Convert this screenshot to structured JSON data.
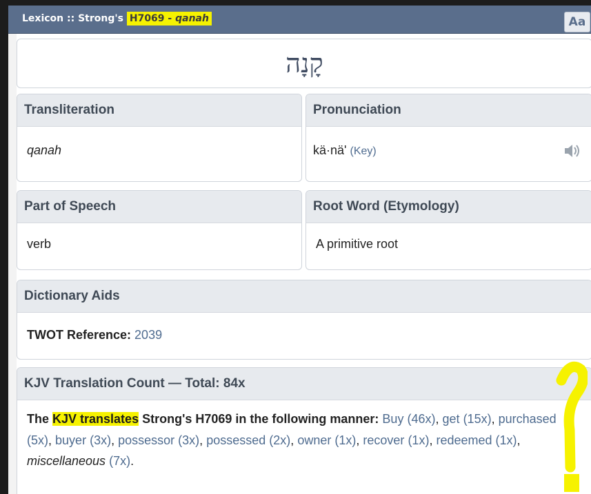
{
  "window": {
    "title_prefix": "Lexicon :: Strong's ",
    "title_strongs": "H7069",
    "title_sep": " - ",
    "title_translit": "qanah",
    "font_button": "Aa"
  },
  "hebrew_word": "קָנָה",
  "transliteration": {
    "label": "Transliteration",
    "value": "qanah"
  },
  "pronunciation": {
    "label": "Pronunciation",
    "value": "kä·nä'",
    "key_link": "(Key)",
    "audio_icon": "speaker-icon"
  },
  "part_of_speech": {
    "label": "Part of Speech",
    "value": "verb"
  },
  "root_word": {
    "label": "Root Word (Etymology)",
    "value": "A primitive root"
  },
  "dictionary_aids": {
    "label": "Dictionary Aids",
    "twot_label": "TWOT Reference:",
    "twot_value": "2039"
  },
  "kjv": {
    "label": "KJV Translation Count — Total: 84x",
    "intro_the": "The ",
    "intro_highlight": "KJV translates",
    "intro_rest": " Strong's H7069 in the following manner:",
    "translations": [
      {
        "word": "Buy",
        "count": "(46x)"
      },
      {
        "word": "get",
        "count": "(15x)"
      },
      {
        "word": "purchased",
        "count": "(5x)"
      },
      {
        "word": "buyer",
        "count": "(3x)"
      },
      {
        "word": "possessor",
        "count": "(3x)"
      },
      {
        "word": "possessed",
        "count": "(2x)"
      },
      {
        "word": "owner",
        "count": "(1x)"
      },
      {
        "word": "recover",
        "count": "(1x)"
      },
      {
        "word": "redeemed",
        "count": "(1x)"
      },
      {
        "word": "miscellaneous",
        "count": "(7x)"
      }
    ]
  },
  "colors": {
    "titlebar": "#5a6e8c",
    "highlight": "#f6f200",
    "link": "#4e6b8f",
    "panel_head": "#e7eaee"
  }
}
